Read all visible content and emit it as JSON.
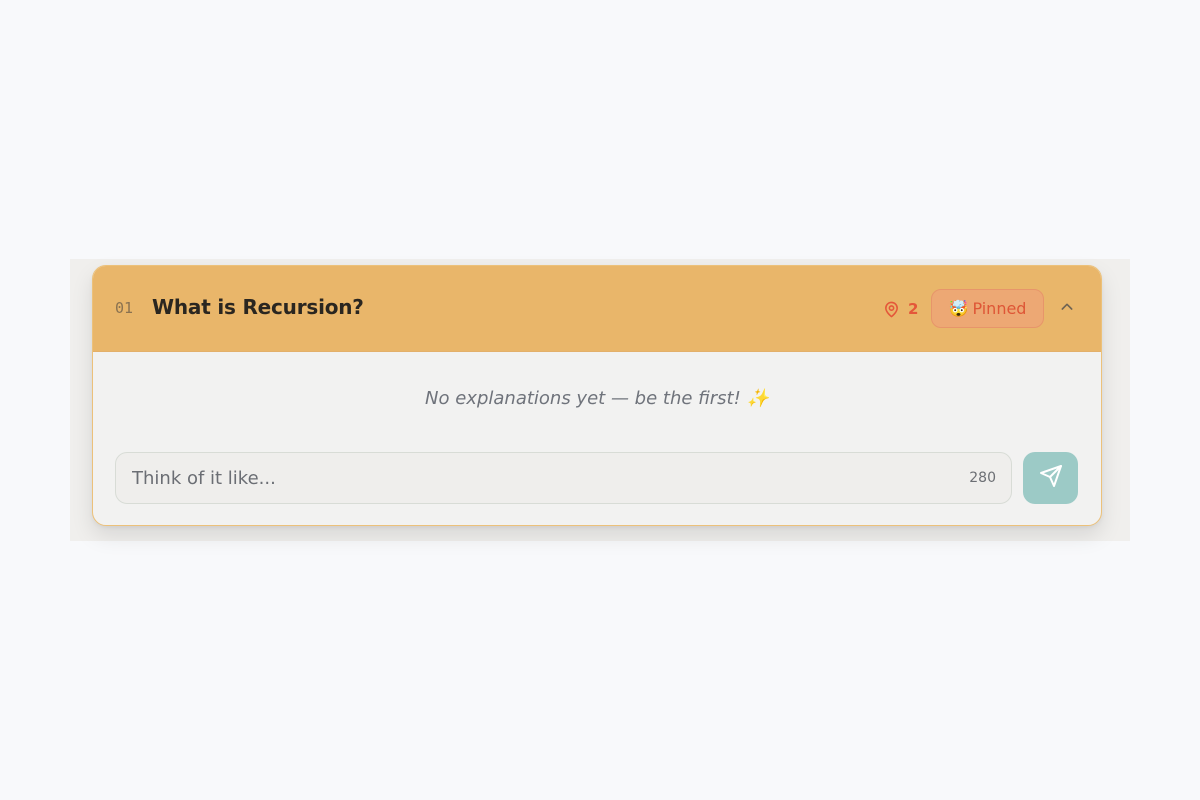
{
  "question": {
    "number": "01",
    "title": "What is Recursion?",
    "pin_count": "2",
    "pinned_emoji": "🤯",
    "pinned_label": "Pinned",
    "empty_message": "No explanations yet — be the first! ✨"
  },
  "composer": {
    "placeholder": "Think of it like...",
    "char_limit": "280"
  },
  "icons": {
    "pin": "map-pin-icon",
    "collapse": "chevron-up-icon",
    "send": "send-icon"
  },
  "colors": {
    "header_bg": "#e9b66a",
    "accent_red": "#e4573a",
    "pinned_bg": "#eda874",
    "send_bg": "#9ccac6"
  }
}
